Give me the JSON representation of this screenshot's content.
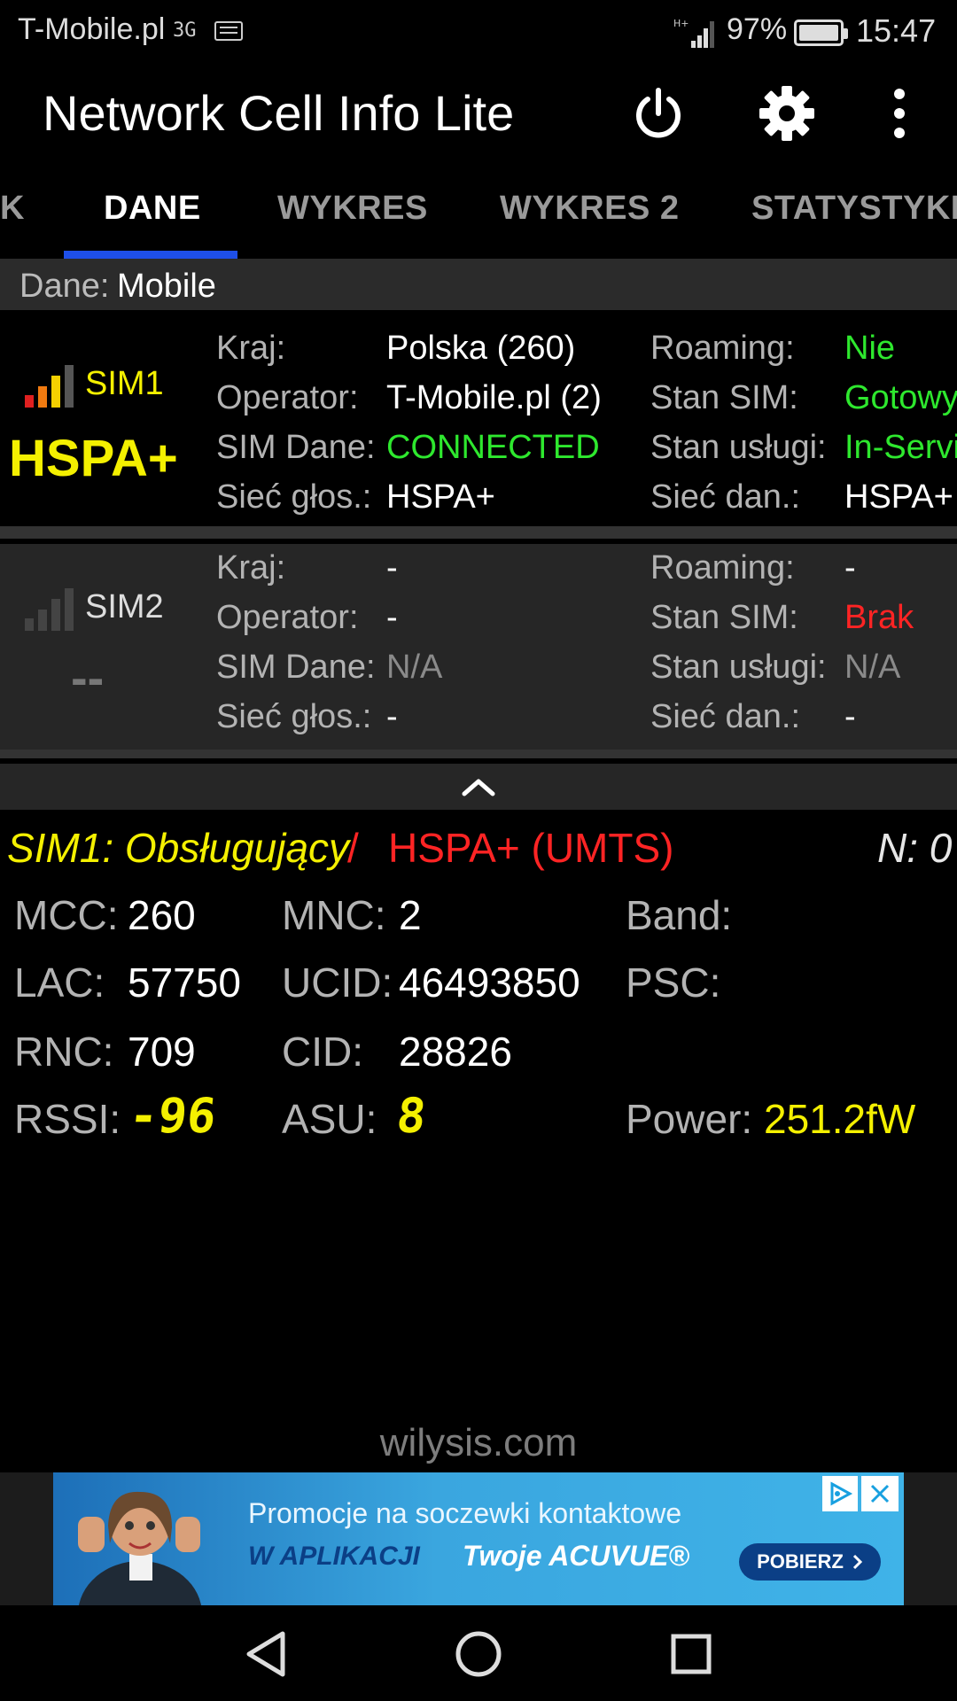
{
  "status_bar": {
    "carrier": "T-Mobile.pl",
    "network_badge": "3G",
    "battery_percent": "97%",
    "time": "15:47"
  },
  "app_bar": {
    "title": "Network Cell Info Lite",
    "icons": [
      "power-icon",
      "gear-icon",
      "more-vert-icon"
    ]
  },
  "tabs": [
    {
      "label": "K"
    },
    {
      "label": "DANE",
      "active": true
    },
    {
      "label": "WYKRES"
    },
    {
      "label": "WYKRES 2"
    },
    {
      "label": "STATYSTYKI"
    }
  ],
  "data_header": {
    "label": "Dane:",
    "value": "Mobile"
  },
  "sim1": {
    "name": "SIM1",
    "tech": "HSPA+",
    "fields_left": [
      {
        "label": "Kraj:",
        "value": "Polska (260)"
      },
      {
        "label": "Operator:",
        "value": "T-Mobile.pl (2)"
      },
      {
        "label": "SIM Dane:",
        "value": "CONNECTED"
      },
      {
        "label": "Sieć głos.:",
        "value": "HSPA+"
      }
    ],
    "fields_right": [
      {
        "label": "Roaming:",
        "value": "Nie"
      },
      {
        "label": "Stan SIM:",
        "value": "Gotowy"
      },
      {
        "label": "Stan usługi:",
        "value": "In-Service"
      },
      {
        "label": "Sieć dan.:",
        "value": "HSPA+"
      }
    ]
  },
  "sim2": {
    "name": "SIM2",
    "tech": "--",
    "fields_left": [
      {
        "label": "Kraj:",
        "value": "-"
      },
      {
        "label": "Operator:",
        "value": "-"
      },
      {
        "label": "SIM Dane:",
        "value": "N/A"
      },
      {
        "label": "Sieć głos.:",
        "value": "-"
      }
    ],
    "fields_right": [
      {
        "label": "Roaming:",
        "value": "-"
      },
      {
        "label": "Stan SIM:",
        "value": "Brak"
      },
      {
        "label": "Stan usługi:",
        "value": "N/A"
      },
      {
        "label": "Sieć dan.:",
        "value": "-"
      }
    ]
  },
  "detail": {
    "heading_sim": "SIM1: Obsługujący",
    "heading_sep": " / ",
    "heading_tech": "HSPA+ (UMTS)",
    "neighbors": "N: 0",
    "mcc_label": "MCC:",
    "mcc": "260",
    "mnc_label": "MNC:",
    "mnc": "2",
    "band_label": "Band:",
    "lac_label": "LAC:",
    "lac": "57750",
    "ucid_label": "UCID:",
    "ucid": "46493850",
    "psc_label": "PSC:",
    "rnc_label": "RNC:",
    "rnc": "709",
    "cid_label": "CID:",
    "cid": "28826",
    "rssi_label": "RSSI:",
    "rssi": "-96",
    "asu_label": "ASU:",
    "asu": "8",
    "power_label": "Power:",
    "power": "251.2fW"
  },
  "website": "wilysis.com",
  "ad": {
    "line1": "Promocje na soczewki kontaktowe",
    "line2a": "W APLIKACJI",
    "line2b": "Twoje ACUVUE®",
    "cta": "POBIERZ"
  },
  "colors": {
    "tab_indicator": "#1e4fe8",
    "yellow": "#f4f000",
    "green": "#2ee82e",
    "red": "#ff2424",
    "label_gray": "#b3b3b3"
  }
}
